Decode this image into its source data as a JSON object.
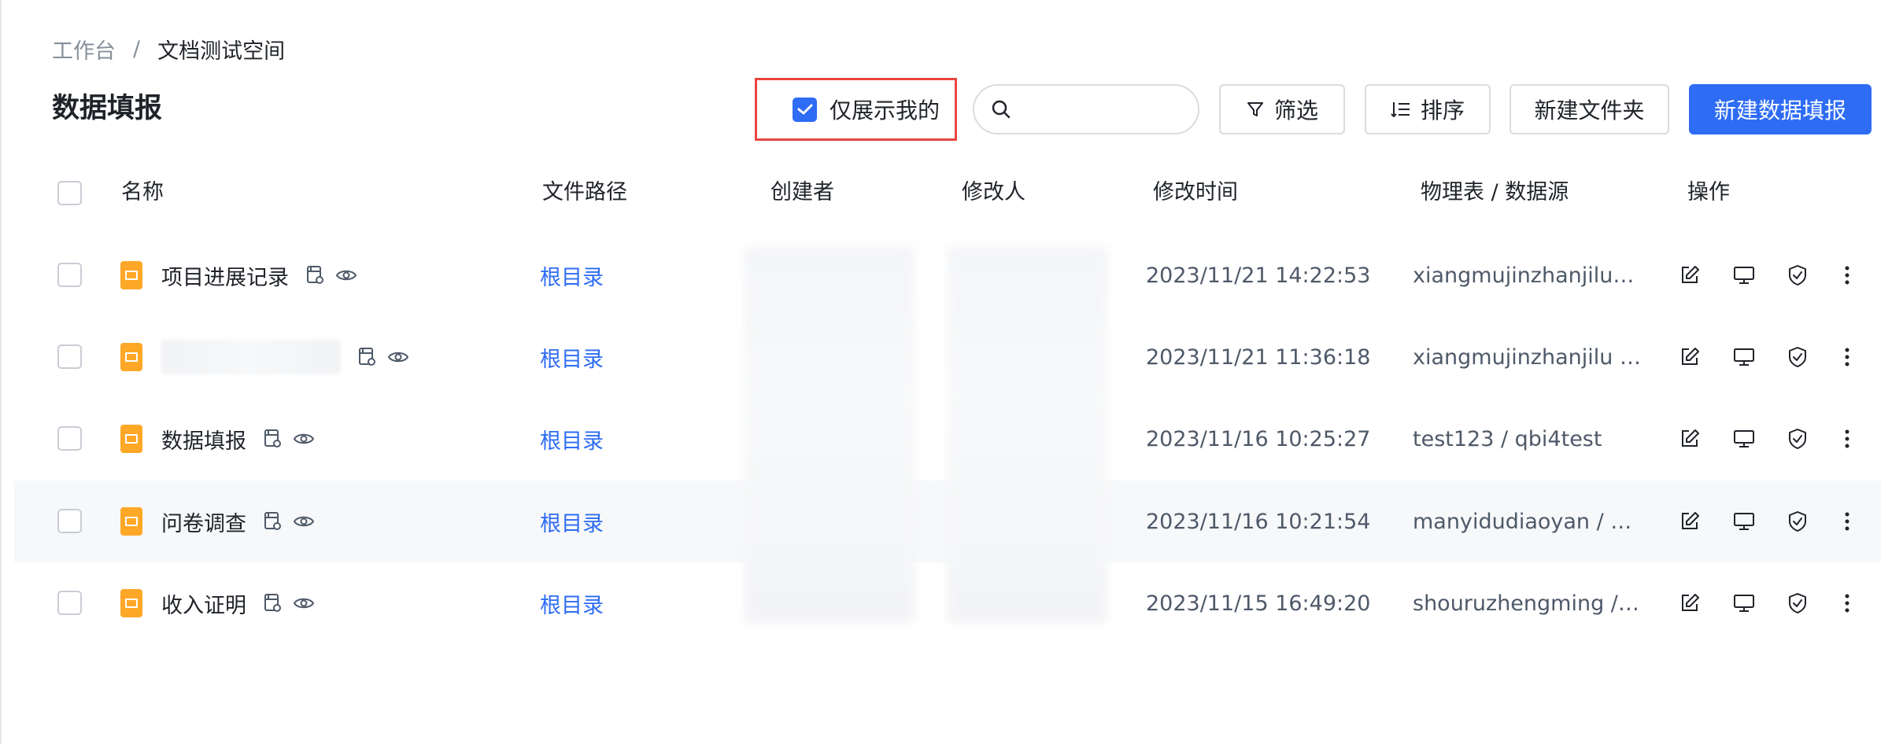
{
  "breadcrumb": {
    "root": "工作台",
    "separator": "/",
    "current": "文档测试空间"
  },
  "page": {
    "title": "数据填报"
  },
  "toolbar": {
    "only_mine_label": "仅展示我的",
    "only_mine_checked": true,
    "search_placeholder": "",
    "filter_label": "筛选",
    "sort_label": "排序",
    "new_folder_label": "新建文件夹",
    "new_form_label": "新建数据填报"
  },
  "table": {
    "columns": {
      "name": "名称",
      "path": "文件路径",
      "creator": "创建者",
      "modifier": "修改人",
      "modified_time": "修改时间",
      "source": "物理表 / 数据源",
      "actions": "操作"
    },
    "rows": [
      {
        "name": "项目进展记录",
        "path": "根目录",
        "modified_time": "2023/11/21 14:22:53",
        "source": "xiangmujinzhanjilu_c..."
      },
      {
        "name": "",
        "path": "根目录",
        "modified_time": "2023/11/21 11:36:18",
        "source": "xiangmujinzhanjilu / ..."
      },
      {
        "name": "数据填报",
        "path": "根目录",
        "modified_time": "2023/11/16 10:25:27",
        "source": "test123 / qbi4test"
      },
      {
        "name": "问卷调查",
        "path": "根目录",
        "modified_time": "2023/11/16 10:21:54",
        "source": "manyidudiaoyan / q..."
      },
      {
        "name": "收入证明",
        "path": "根目录",
        "modified_time": "2023/11/15 16:49:20",
        "source": "shouruzhengming / ..."
      }
    ]
  },
  "colors": {
    "primary": "#2e6cf5",
    "file_icon": "#ffa726",
    "highlight_border": "#e8463f"
  }
}
